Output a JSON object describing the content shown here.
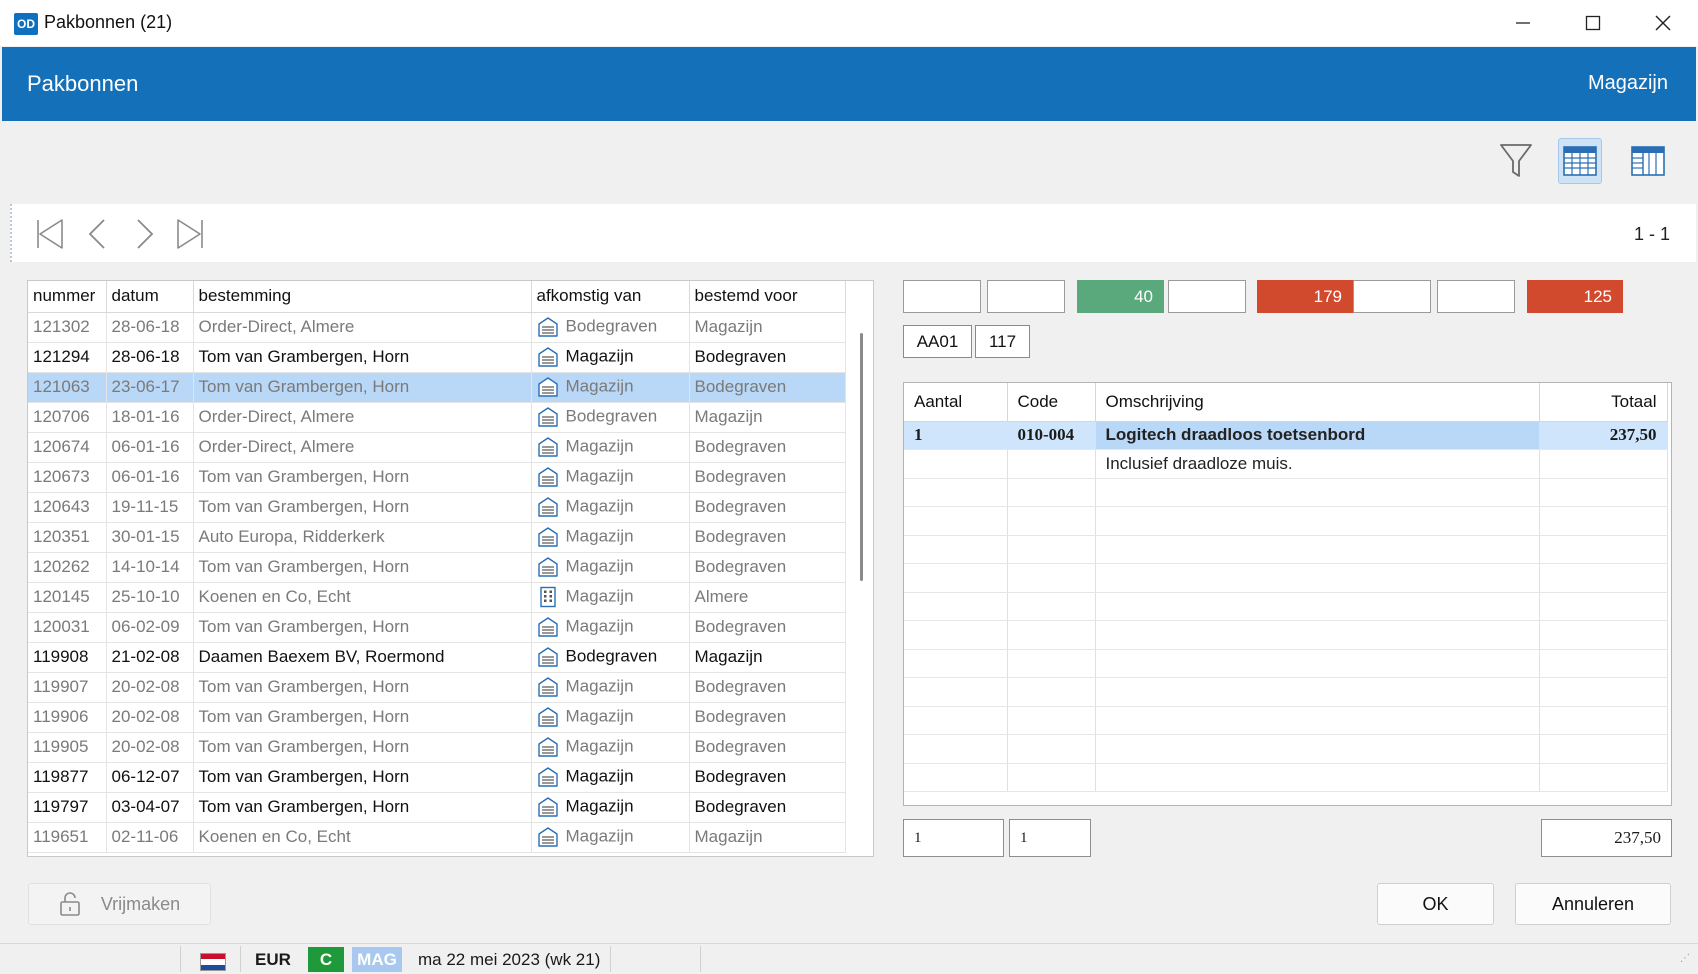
{
  "window": {
    "icon_text": "OD",
    "title": "Pakbonnen (21)"
  },
  "header": {
    "title": "Pakbonnen",
    "context": "Magazijn"
  },
  "toolbar": {
    "icons": [
      "filter-icon",
      "table-view-icon",
      "columns-view-icon"
    ],
    "active_icon": "table-view-icon"
  },
  "navigation": {
    "pager": "1 - 1",
    "icons": [
      "first-record-icon",
      "previous-record-icon",
      "next-record-icon",
      "last-record-icon"
    ]
  },
  "list": {
    "columns": [
      "nummer",
      "datum",
      "bestemming",
      "afkomstig van",
      "bestemd voor"
    ],
    "rows": [
      {
        "nummer": "121302",
        "datum": "28-06-18",
        "bestemming": "Order-Direct, Almere",
        "afkomstig_van": "Bodegraven",
        "bestemd_voor": "Magazijn",
        "icon": "warehouse-icon",
        "bold": false,
        "selected": false
      },
      {
        "nummer": "121294",
        "datum": "28-06-18",
        "bestemming": "Tom van Grambergen, Horn",
        "afkomstig_van": "Magazijn",
        "bestemd_voor": "Bodegraven",
        "icon": "warehouse-icon",
        "bold": true,
        "selected": false
      },
      {
        "nummer": "121063",
        "datum": "23-06-17",
        "bestemming": "Tom van Grambergen, Horn",
        "afkomstig_van": "Magazijn",
        "bestemd_voor": "Bodegraven",
        "icon": "warehouse-icon",
        "bold": true,
        "selected": true
      },
      {
        "nummer": "120706",
        "datum": "18-01-16",
        "bestemming": "Order-Direct, Almere",
        "afkomstig_van": "Bodegraven",
        "bestemd_voor": "Magazijn",
        "icon": "warehouse-icon",
        "bold": false,
        "selected": false
      },
      {
        "nummer": "120674",
        "datum": "06-01-16",
        "bestemming": "Order-Direct, Almere",
        "afkomstig_van": "Magazijn",
        "bestemd_voor": "Bodegraven",
        "icon": "warehouse-icon",
        "bold": false,
        "selected": false
      },
      {
        "nummer": "120673",
        "datum": "06-01-16",
        "bestemming": "Tom van Grambergen, Horn",
        "afkomstig_van": "Magazijn",
        "bestemd_voor": "Bodegraven",
        "icon": "warehouse-icon",
        "bold": false,
        "selected": false
      },
      {
        "nummer": "120643",
        "datum": "19-11-15",
        "bestemming": "Tom van Grambergen, Horn",
        "afkomstig_van": "Magazijn",
        "bestemd_voor": "Bodegraven",
        "icon": "warehouse-icon",
        "bold": false,
        "selected": false
      },
      {
        "nummer": "120351",
        "datum": "30-01-15",
        "bestemming": "Auto Europa, Ridderkerk",
        "afkomstig_van": "Magazijn",
        "bestemd_voor": "Bodegraven",
        "icon": "warehouse-icon",
        "bold": false,
        "selected": false
      },
      {
        "nummer": "120262",
        "datum": "14-10-14",
        "bestemming": "Tom van Grambergen, Horn",
        "afkomstig_van": "Magazijn",
        "bestemd_voor": "Bodegraven",
        "icon": "warehouse-icon",
        "bold": false,
        "selected": false
      },
      {
        "nummer": "120145",
        "datum": "25-10-10",
        "bestemming": "Koenen en Co, Echt",
        "afkomstig_van": "Magazijn",
        "bestemd_voor": "Almere",
        "icon": "building-icon",
        "bold": false,
        "selected": false
      },
      {
        "nummer": "120031",
        "datum": "06-02-09",
        "bestemming": "Tom van Grambergen, Horn",
        "afkomstig_van": "Magazijn",
        "bestemd_voor": "Bodegraven",
        "icon": "warehouse-icon",
        "bold": false,
        "selected": false
      },
      {
        "nummer": "119908",
        "datum": "21-02-08",
        "bestemming": "Daamen Baexem BV, Roermond",
        "afkomstig_van": "Bodegraven",
        "bestemd_voor": "Magazijn",
        "icon": "warehouse-icon",
        "bold": true,
        "selected": false
      },
      {
        "nummer": "119907",
        "datum": "20-02-08",
        "bestemming": "Tom van Grambergen, Horn",
        "afkomstig_van": "Magazijn",
        "bestemd_voor": "Bodegraven",
        "icon": "warehouse-icon",
        "bold": false,
        "selected": false
      },
      {
        "nummer": "119906",
        "datum": "20-02-08",
        "bestemming": "Tom van Grambergen, Horn",
        "afkomstig_van": "Magazijn",
        "bestemd_voor": "Bodegraven",
        "icon": "warehouse-icon",
        "bold": false,
        "selected": false
      },
      {
        "nummer": "119905",
        "datum": "20-02-08",
        "bestemming": "Tom van Grambergen, Horn",
        "afkomstig_van": "Magazijn",
        "bestemd_voor": "Bodegraven",
        "icon": "warehouse-icon",
        "bold": false,
        "selected": false
      },
      {
        "nummer": "119877",
        "datum": "06-12-07",
        "bestemming": "Tom van Grambergen, Horn",
        "afkomstig_van": "Magazijn",
        "bestemd_voor": "Bodegraven",
        "icon": "warehouse-icon",
        "bold": true,
        "selected": false
      },
      {
        "nummer": "119797",
        "datum": "03-04-07",
        "bestemming": "Tom van Grambergen, Horn",
        "afkomstig_van": "Magazijn",
        "bestemd_voor": "Bodegraven",
        "icon": "warehouse-icon",
        "bold": true,
        "selected": false
      },
      {
        "nummer": "119651",
        "datum": "02-11-06",
        "bestemming": "Koenen en Co, Echt",
        "afkomstig_van": "Magazijn",
        "bestemd_voor": "Magazijn",
        "icon": "warehouse-icon",
        "bold": false,
        "selected": false
      }
    ]
  },
  "status_boxes": [
    {
      "value": "",
      "color": "#ffffff"
    },
    {
      "value": "",
      "color": "#ffffff"
    },
    {
      "value": "40",
      "color": "#5aa97c"
    },
    {
      "value": "",
      "color": "#ffffff"
    },
    {
      "value": "179",
      "color": "#d24a2e"
    },
    {
      "value": "",
      "color": "#ffffff"
    },
    {
      "value": "",
      "color": "#ffffff"
    },
    {
      "value": "125",
      "color": "#d24a2e"
    }
  ],
  "tags": [
    "AA01",
    "117"
  ],
  "lines": {
    "columns": [
      "Aantal",
      "Code",
      "Omschrijving",
      "Totaal"
    ],
    "rows": [
      {
        "aantal": "1",
        "code": "010-004",
        "omschrijving": "Logitech draadloos toetsenbord",
        "totaal": "237,50",
        "selected": true
      },
      {
        "aantal": "",
        "code": "",
        "omschrijving": "Inclusief draadloze muis.",
        "totaal": "",
        "selected": false
      }
    ],
    "empty_rows": 11
  },
  "footer_fields": {
    "field1": "1",
    "field2": "1",
    "total": "237,50"
  },
  "buttons": {
    "release": "Vrijmaken",
    "ok": "OK",
    "cancel": "Annuleren"
  },
  "statusbar": {
    "currency": "EUR",
    "mode": "C",
    "location": "MAG",
    "date": "ma 22 mei 2023 (wk 21)",
    "flag": "dutch-flag-icon",
    "mode_color": "#1e9a3a",
    "location_color": "#a8c8ef"
  }
}
